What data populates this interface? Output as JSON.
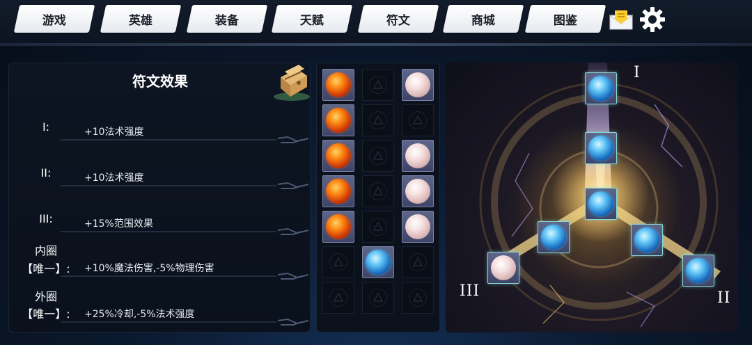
{
  "nav": {
    "tabs": [
      "游戏",
      "英雄",
      "装备",
      "天赋",
      "符文",
      "商城",
      "图鉴"
    ],
    "mail_icon": "mail-icon",
    "settings_icon": "gear-icon"
  },
  "effects": {
    "title": "符文效果",
    "chest_icon": "treasure-chest-icon",
    "rows": [
      {
        "label": "I:",
        "text": "+10法术强度"
      },
      {
        "label": "II:",
        "text": "+10法术强度"
      },
      {
        "label": "III:",
        "text": "+15%范围效果"
      },
      {
        "label": "内圈\n【唯一】:",
        "text": "+10%魔法伤害,-5%物理伤害"
      },
      {
        "label": "外圈\n【唯一】:",
        "text": "+25%冷却,-5%法术强度"
      }
    ],
    "row_labels_line1": [
      "I:",
      "II:",
      "III:",
      "内圈",
      "外圈"
    ],
    "row_labels_line2": [
      "",
      "",
      "",
      "【唯一】:",
      "【唯一】:"
    ]
  },
  "inventory": {
    "columns": 3,
    "rows": [
      [
        "red",
        "empty",
        "white"
      ],
      [
        "red",
        "empty",
        "empty"
      ],
      [
        "red",
        "empty",
        "white"
      ],
      [
        "red",
        "empty",
        "white"
      ],
      [
        "red",
        "empty",
        "white"
      ],
      [
        "empty",
        "blue",
        "empty"
      ],
      [
        "empty",
        "empty",
        "empty"
      ]
    ]
  },
  "rune_tree": {
    "tier_labels": [
      "I",
      "II",
      "III"
    ],
    "slots": [
      {
        "id": "top",
        "orb": "blue"
      },
      {
        "id": "upper-mid",
        "orb": "blue"
      },
      {
        "id": "center",
        "orb": "blue"
      },
      {
        "id": "left-inner",
        "orb": "blue"
      },
      {
        "id": "right-inner",
        "orb": "blue"
      },
      {
        "id": "left-outer",
        "orb": "white"
      },
      {
        "id": "right-outer",
        "orb": "blue"
      }
    ]
  },
  "colors": {
    "orb_red": "#e0500e",
    "orb_white": "#f1d6d6",
    "orb_blue": "#3aa6ea",
    "slot_border_active": "#8ad7d0"
  }
}
